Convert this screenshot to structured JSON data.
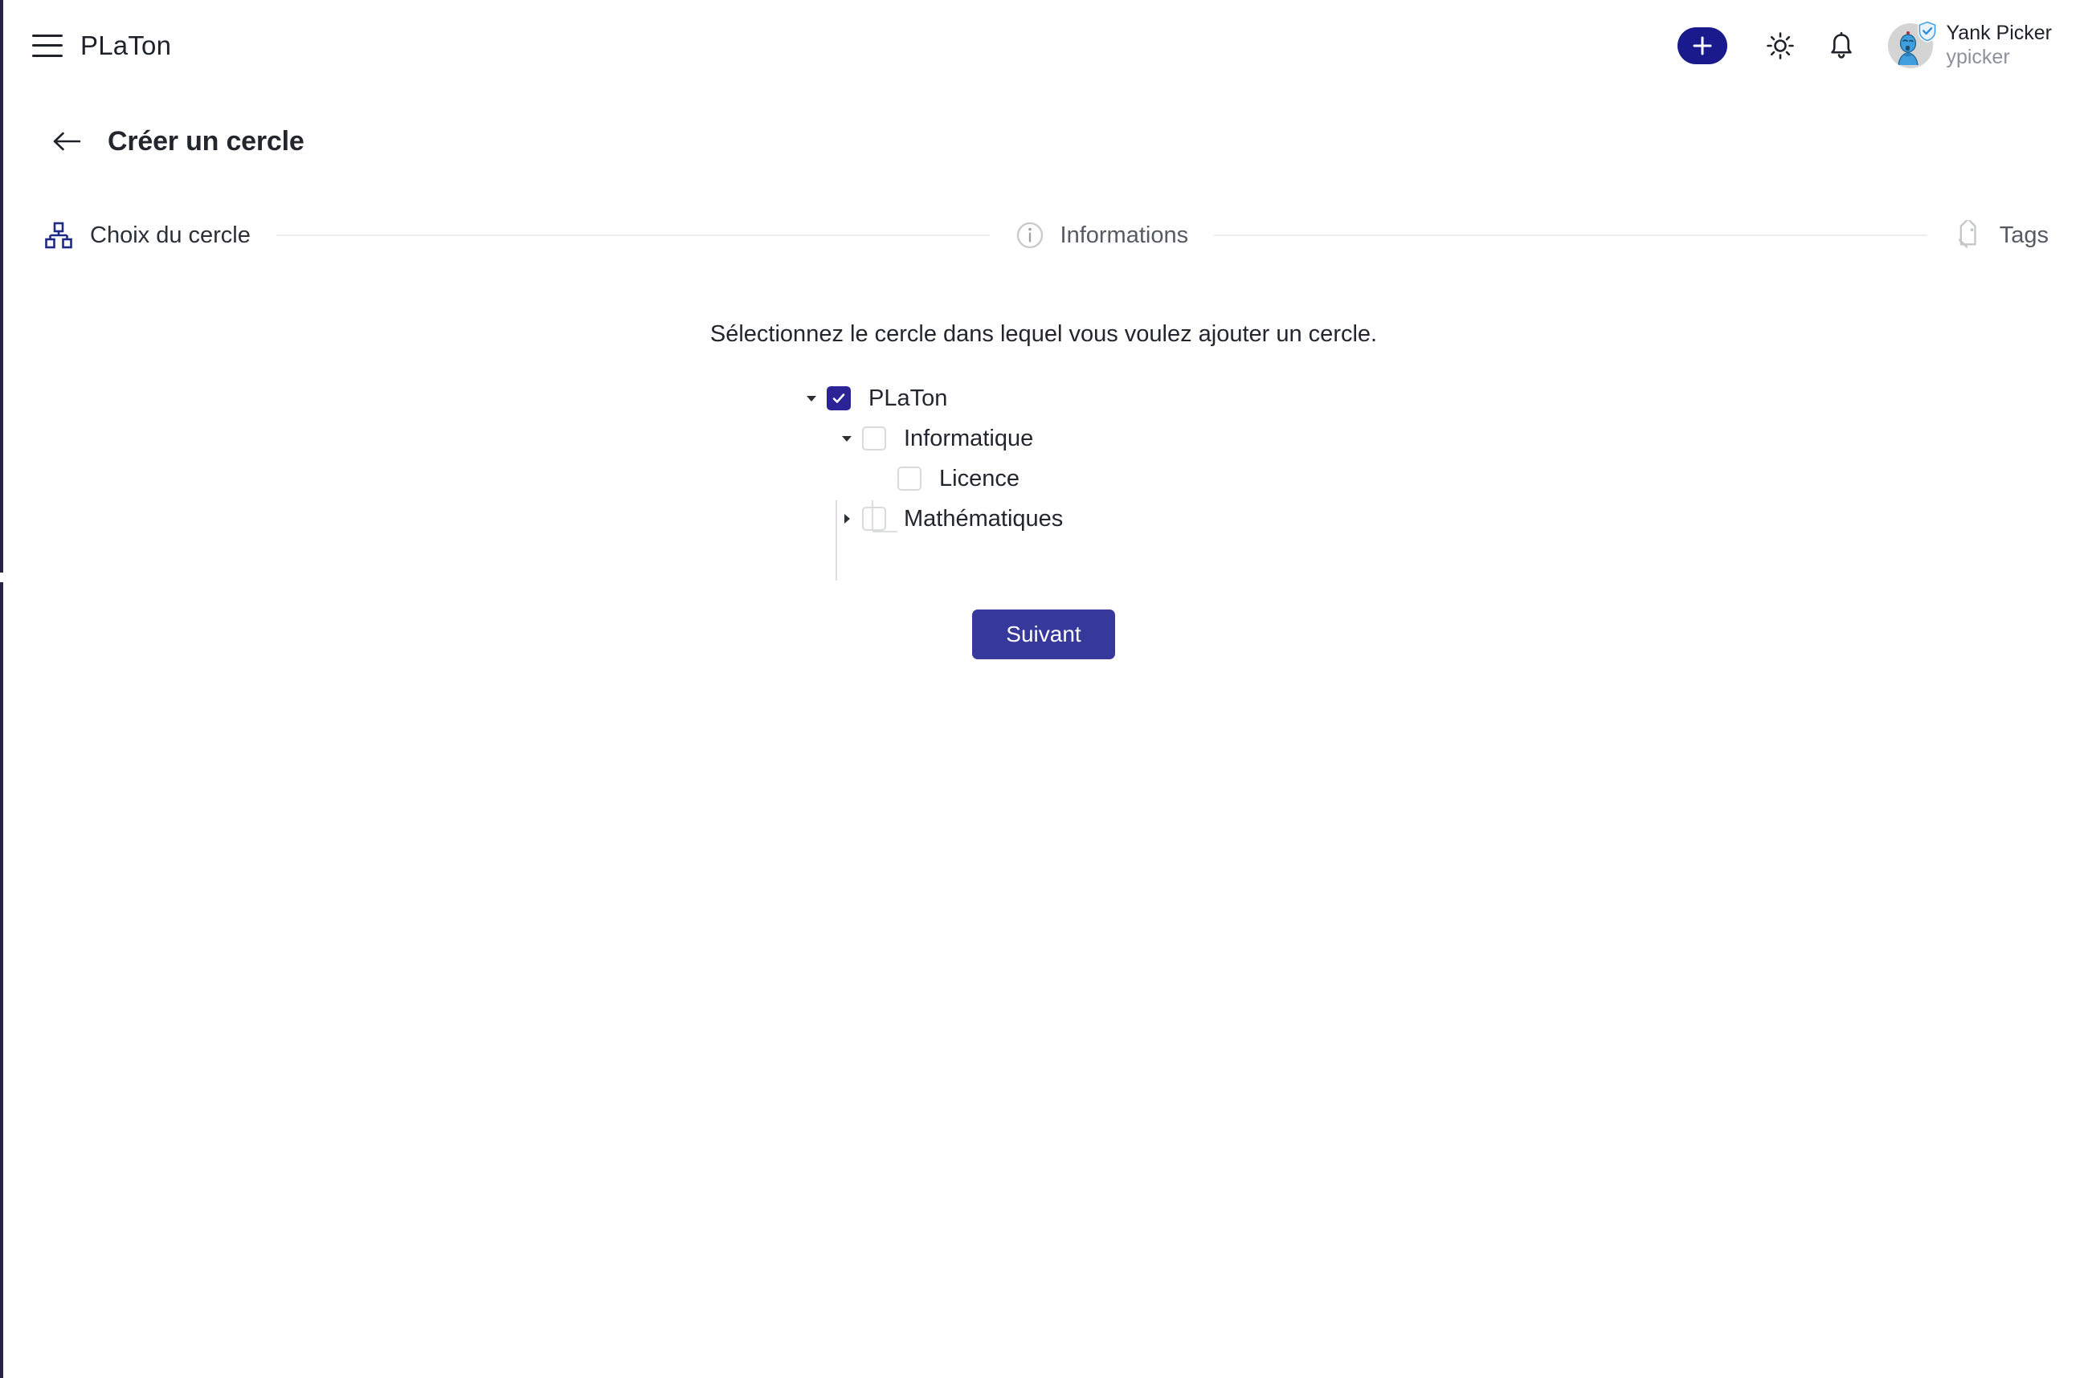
{
  "app": {
    "brand": "PLaTon",
    "accent_primary": "#1a1a8c",
    "accent_button": "#36399b",
    "sidebar_edge_color": "#2b2346"
  },
  "topbar": {
    "menu_icon": "hamburger-menu-icon",
    "add_label": "+",
    "add_icon": "plus-icon",
    "theme_icon": "sun-icon",
    "notifications_icon": "bell-icon",
    "profile": {
      "name": "Yank Picker",
      "handle": "ypicker",
      "avatar_icon": "robot-avatar",
      "verified_icon": "verified-shield-icon"
    }
  },
  "header": {
    "back_icon": "arrow-left-icon",
    "title": "Créer un cercle"
  },
  "stepper": {
    "steps": [
      {
        "label": "Choix du cercle",
        "icon": "sitemap-icon",
        "state": "active"
      },
      {
        "label": "Informations",
        "icon": "info-circle-icon",
        "state": "inactive"
      },
      {
        "label": "Tags",
        "icon": "tag-icon",
        "state": "inactive"
      }
    ]
  },
  "main": {
    "instruction": "Sélectionnez le cercle dans lequel vous voulez ajouter un cercle.",
    "tree": [
      {
        "label": "PLaTon",
        "level": 1,
        "checked": true,
        "expanded": true,
        "has_children": true
      },
      {
        "label": "Informatique",
        "level": 2,
        "checked": false,
        "expanded": true,
        "has_children": true
      },
      {
        "label": "Licence",
        "level": 3,
        "checked": false,
        "expanded": false,
        "has_children": false
      },
      {
        "label": "Mathématiques",
        "level": 2,
        "checked": false,
        "expanded": false,
        "has_children": true
      }
    ],
    "submit_label": "Suivant"
  }
}
